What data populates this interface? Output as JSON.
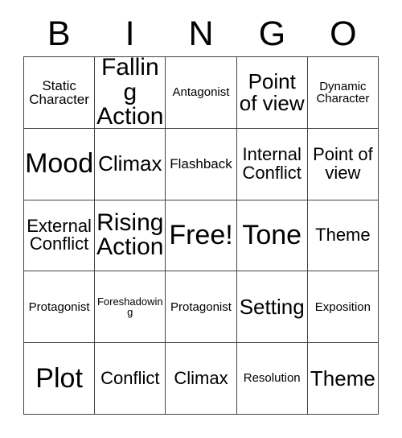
{
  "card": {
    "title": "Bingo Card",
    "header_letters": [
      "B",
      "I",
      "N",
      "G",
      "O"
    ],
    "free_space_label": "Free!",
    "grid_line_color": "#444444",
    "text_color": "#000000",
    "background_color": "#ffffff",
    "rows": [
      [
        {
          "text": "Static Character",
          "size": "sm"
        },
        {
          "text": "Falling Action",
          "size": "xl"
        },
        {
          "text": "Antagonist",
          "size": "xs"
        },
        {
          "text": "Point of view",
          "size": "lg"
        },
        {
          "text": "Dynamic Character",
          "size": "xs"
        }
      ],
      [
        {
          "text": "Mood",
          "size": "xxl"
        },
        {
          "text": "Climax",
          "size": "lg"
        },
        {
          "text": "Flashback",
          "size": "sm"
        },
        {
          "text": "Internal Conflict",
          "size": "md"
        },
        {
          "text": "Point of view",
          "size": "md"
        }
      ],
      [
        {
          "text": "External Conflict",
          "size": "md"
        },
        {
          "text": "Rising Action",
          "size": "xl"
        },
        {
          "text": "Free!",
          "size": "xxl"
        },
        {
          "text": "Tone",
          "size": "xxl"
        },
        {
          "text": "Theme",
          "size": "md"
        }
      ],
      [
        {
          "text": "Protagonist",
          "size": "xs"
        },
        {
          "text": "Foreshadowing",
          "size": "xxs"
        },
        {
          "text": "Protagonist",
          "size": "xs"
        },
        {
          "text": "Setting",
          "size": "lg"
        },
        {
          "text": "Exposition",
          "size": "xs"
        }
      ],
      [
        {
          "text": "Plot",
          "size": "xxl"
        },
        {
          "text": "Conflict",
          "size": "md"
        },
        {
          "text": "Climax",
          "size": "md"
        },
        {
          "text": "Resolution",
          "size": "xs"
        },
        {
          "text": "Theme",
          "size": "lg"
        }
      ]
    ]
  }
}
